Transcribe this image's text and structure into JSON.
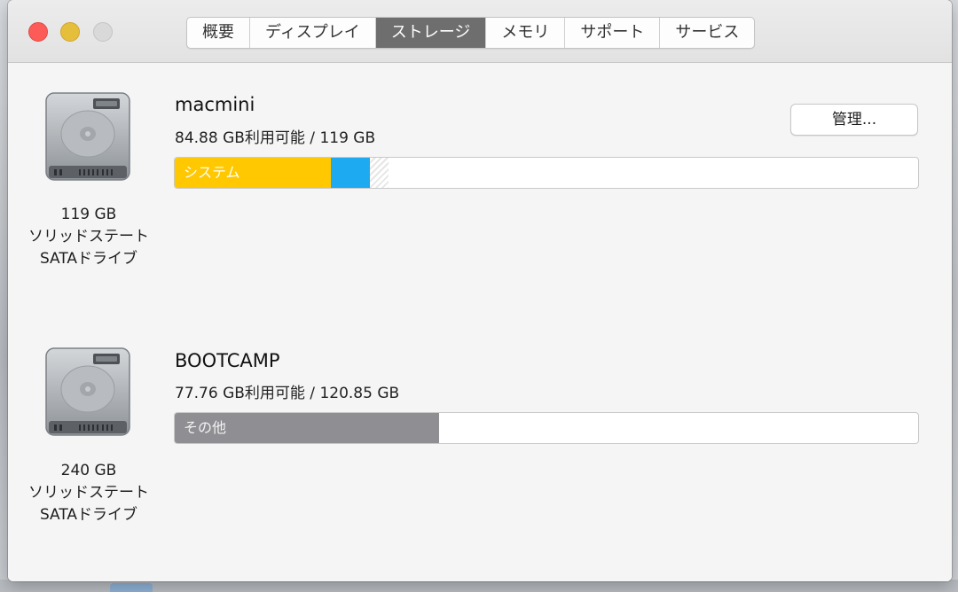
{
  "tabs": [
    {
      "label": "概要",
      "active": false
    },
    {
      "label": "ディスプレイ",
      "active": false
    },
    {
      "label": "ストレージ",
      "active": true
    },
    {
      "label": "メモリ",
      "active": false
    },
    {
      "label": "サポート",
      "active": false
    },
    {
      "label": "サービス",
      "active": false
    }
  ],
  "manage_button": {
    "label": "管理..."
  },
  "volumes": [
    {
      "name": "macmini",
      "usage": "84.88 GB利用可能 / 119 GB",
      "drive": {
        "capacity": "119 GB",
        "type": "ソリッドステート",
        "interface": "SATAドライブ"
      },
      "segments": [
        {
          "label": "システム",
          "fraction": 0.21,
          "color": "#ffc800",
          "pattern": "solid"
        },
        {
          "label": "",
          "fraction": 0.052,
          "color": "#1eaaf1",
          "pattern": "solid"
        },
        {
          "label": "",
          "fraction": 0.026,
          "color": "#e6e6e6",
          "pattern": "striped"
        }
      ]
    },
    {
      "name": "BOOTCAMP",
      "usage": "77.76 GB利用可能 / 120.85 GB",
      "drive": {
        "capacity": "240 GB",
        "type": "ソリッドステート",
        "interface": "SATAドライブ"
      },
      "segments": [
        {
          "label": "その他",
          "fraction": 0.356,
          "color": "#8e8e93",
          "pattern": "solid"
        }
      ]
    }
  ],
  "icons": {
    "drive": "hard-drive-icon"
  }
}
